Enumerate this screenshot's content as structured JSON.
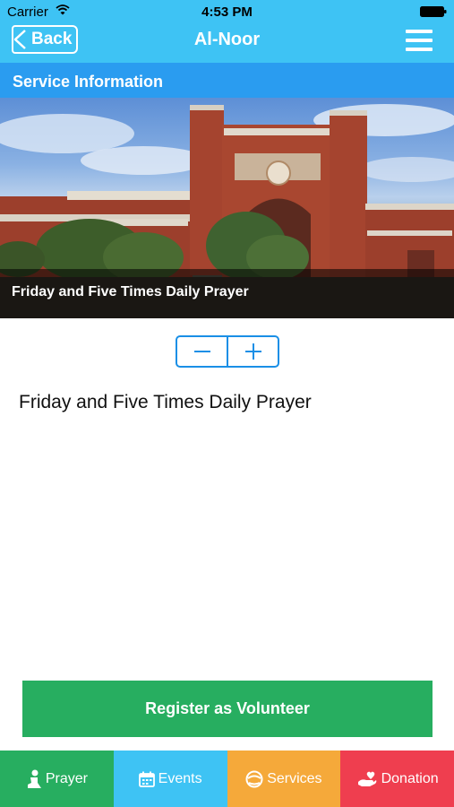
{
  "status_bar": {
    "carrier": "Carrier",
    "time": "4:53 PM"
  },
  "nav": {
    "back_label": "Back",
    "title": "Al-Noor",
    "back_icon": "chevron-left-icon",
    "menu_icon": "hamburger-menu-icon"
  },
  "section": {
    "title": "Service Information"
  },
  "hero": {
    "caption": "Friday and Five Times Daily Prayer"
  },
  "stepper": {
    "decrease_icon": "minus-icon",
    "increase_icon": "plus-icon"
  },
  "content": {
    "description": "Friday and Five Times Daily Prayer"
  },
  "register": {
    "label": "Register as Volunteer"
  },
  "tabs": [
    {
      "label": "Prayer",
      "icon": "prayer-icon",
      "color": "#27ae60"
    },
    {
      "label": "Events",
      "icon": "calendar-icon",
      "color": "#3ec3f4"
    },
    {
      "label": "Services",
      "icon": "services-icon",
      "color": "#f5a93a"
    },
    {
      "label": "Donation",
      "icon": "donation-icon",
      "color": "#ef3e4f"
    }
  ],
  "colors": {
    "header": "#3ec3f4",
    "section": "#2a9cf0",
    "accent": "#1a8fe6",
    "register": "#27ae60"
  }
}
